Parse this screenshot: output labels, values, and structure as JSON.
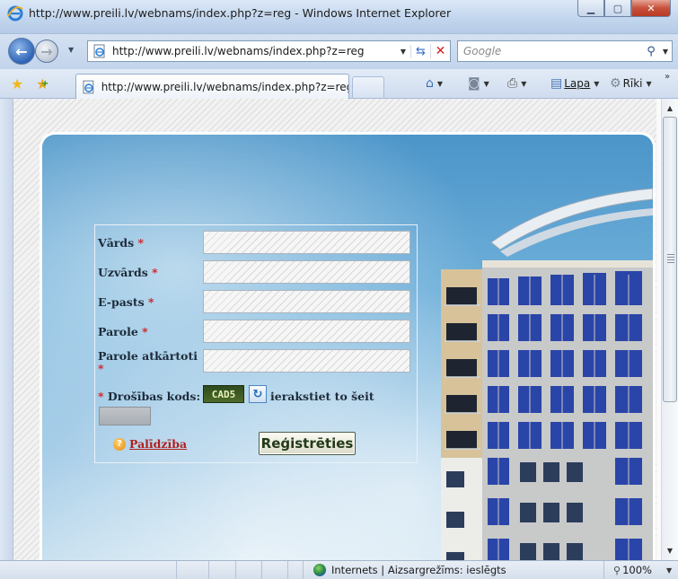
{
  "window": {
    "title": "http://www.preili.lv/webnams/index.php?z=reg - Windows Internet Explorer",
    "minimize_symbol": "▁",
    "maximize_symbol": "▢",
    "close_symbol": "✕"
  },
  "navigation": {
    "back_symbol": "←",
    "forward_symbol": "→",
    "address_url": "http://www.preili.lv/webnams/index.php?z=reg",
    "search_placeholder": "Google"
  },
  "tabs": [
    {
      "label": "http://www.preili.lv/webnams/index.php?z=reg",
      "active": true
    }
  ],
  "command_bar": {
    "page_label": "Lapa",
    "tools_label": "Rīki"
  },
  "form": {
    "fields": [
      {
        "label": "Vārds",
        "required_mark": "*",
        "value": ""
      },
      {
        "label": "Uzvārds",
        "required_mark": "*",
        "value": ""
      },
      {
        "label": "E-pasts",
        "required_mark": "*",
        "value": ""
      },
      {
        "label": "Parole",
        "required_mark": "*",
        "value": ""
      },
      {
        "label": "Parole atkārtoti",
        "required_mark": "*",
        "value": ""
      }
    ],
    "captcha": {
      "required_mark": "*",
      "label": "Drošības kods:",
      "code": "CAD5",
      "hint": "ierakstiet to šeit",
      "value": ""
    },
    "help_link": "Palīdzība",
    "submit_label": "Reģistrēties"
  },
  "status_bar": {
    "zone_text": "Internets | Aizsargrežīms: ieslēgts",
    "zoom": "100%"
  },
  "colors": {
    "required": "#d11c1c",
    "help_link": "#b02020",
    "sky_top": "#4b95c9",
    "sky_bottom": "#cfe4f1"
  }
}
